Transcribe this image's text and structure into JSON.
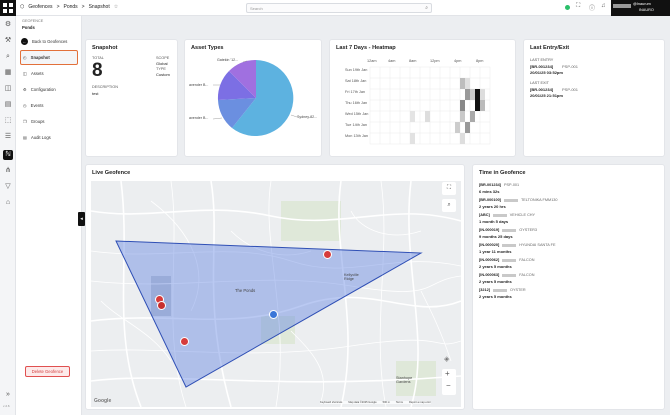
{
  "breadcrumb": {
    "items": [
      "Geofences",
      "Ponds",
      "Snapshot"
    ],
    "sep": ">"
  },
  "search": {
    "placeholder": "Search"
  },
  "user": {
    "name": "@Inaurum",
    "org": "INAURO"
  },
  "sidebar": {
    "section": "GEOFENCE",
    "name": "Ponds",
    "back": "Back to Geofences",
    "items": [
      {
        "label": "Snapshot",
        "icon": "snapshot-icon"
      },
      {
        "label": "Assets",
        "icon": "assets-icon"
      },
      {
        "label": "Configuration",
        "icon": "configuration-icon"
      },
      {
        "label": "Events",
        "icon": "events-icon"
      },
      {
        "label": "Groups",
        "icon": "groups-icon"
      },
      {
        "label": "Audit Logs",
        "icon": "audit-icon"
      }
    ],
    "delete": "Delete Geofence",
    "version": "v 2.6"
  },
  "snapshot": {
    "title": "Snapshot",
    "total_label": "TOTAL",
    "total": "8",
    "scope_label": "SCOPE",
    "scope": "Global",
    "type_label": "TYPE",
    "type": "Custom",
    "desc_label": "DESCRIPTION",
    "desc": "test"
  },
  "asset_types": {
    "title": "Asset Types",
    "labels": [
      "Gatekin '12...",
      "avender B...",
      "avender B...",
      "Sydney-82..."
    ]
  },
  "heatmap": {
    "title": "Last 7 Days - Heatmap",
    "hours": [
      "12am",
      "4am",
      "8am",
      "12pm",
      "4pm",
      "8pm"
    ],
    "days": [
      "Sun 19th Jan",
      "Sat 18th Jan",
      "Fri 17th Jan",
      "Thu 16th Jan",
      "Wed 15th Jan",
      "Tue 14th Jan",
      "Mon 13th Jan"
    ]
  },
  "entry_exit": {
    "title": "Last Entry/Exit",
    "entry_label": "LAST ENTRY",
    "entry_id": "[BR-001234]",
    "entry_name": "PSP-001",
    "entry_time": "20/01/25 03:52pm",
    "exit_label": "LAST EXIT",
    "exit_id": "[BR-001234]",
    "exit_name": "PSP-001",
    "exit_time": "20/01/25 21:51pm"
  },
  "map": {
    "title": "Live Geofence",
    "place1": "The Ponds",
    "place2": "Kellyville Ridge",
    "place3": "Stanhope Gardens",
    "footer": [
      "Keyboard shortcuts",
      "Map data ©2025 Google",
      "500 m",
      "Terms",
      "Report a map error"
    ],
    "google": "Google"
  },
  "time_in": {
    "title": "Time in Geofence",
    "rows": [
      {
        "id": "[BR-001234]",
        "name": "PSP-001",
        "dur": "6 mins 32s"
      },
      {
        "id": "[BR-000100]",
        "name": "TELTONIKA FMM130",
        "dur": "2 years 20 hrs"
      },
      {
        "id": "[ABC]",
        "name": "VEHICLE CHY",
        "dur": "1 month 5 days"
      },
      {
        "id": "[IN-000019]",
        "name": "OYSTER3",
        "dur": "9 months 25 days"
      },
      {
        "id": "[IN-000020]",
        "name": "HYUNDAI SANTA FE",
        "dur": "1 year 11 months"
      },
      {
        "id": "[IN-000062]",
        "name": "FALCON",
        "dur": "2 years 5 months"
      },
      {
        "id": "[IN-000063]",
        "name": "FALCON",
        "dur": "2 years 5 months"
      },
      {
        "id": "[3212]",
        "name": "OYSTER",
        "dur": "2 years 5 months"
      }
    ]
  }
}
